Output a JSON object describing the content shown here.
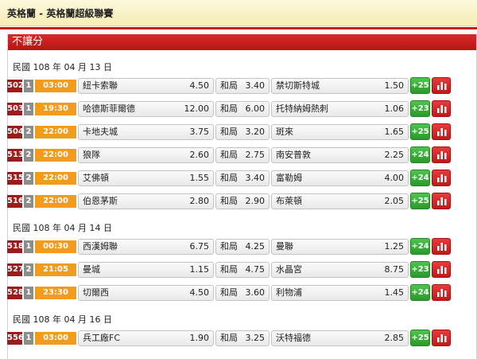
{
  "header": {
    "title": "英格蘭 - 英格蘭超級聯賽"
  },
  "panel": {
    "title": "不讓分"
  },
  "colors": {
    "match_no": "#9e1b1b",
    "league": "#8c8c8c",
    "time": "#f29b1d",
    "more": "#2a9a2a",
    "stats": "#c11919",
    "panel_head": "#c8161d"
  },
  "dates": [
    {
      "label": "民國 108 年 04 月 13 日",
      "matches": [
        {
          "no": "502",
          "lg": "1",
          "time": "03:00 (六)",
          "home": "紐卡索聯",
          "home_odds": "4.50",
          "draw": "和局",
          "draw_odds": "3.40",
          "away": "禁切斯特城",
          "away_odds": "1.50",
          "more": "+25"
        },
        {
          "no": "503",
          "lg": "1",
          "time": "19:30 (六)",
          "home": "哈德斯菲爾德",
          "home_odds": "12.00",
          "draw": "和局",
          "draw_odds": "6.00",
          "away": "托特納姆熱刺",
          "away_odds": "1.06",
          "more": "+23"
        },
        {
          "no": "504",
          "lg": "2",
          "time": "22:00 (六)",
          "home": "卡地夫城",
          "home_odds": "3.75",
          "draw": "和局",
          "draw_odds": "3.20",
          "away": "斑來",
          "away_odds": "1.65",
          "more": "+25"
        },
        {
          "no": "513",
          "lg": "2",
          "time": "22:00 (六)",
          "home": "狼隊",
          "home_odds": "2.60",
          "draw": "和局",
          "draw_odds": "2.75",
          "away": "南安普敦",
          "away_odds": "2.25",
          "more": "+24"
        },
        {
          "no": "515",
          "lg": "2",
          "time": "22:00 (六)",
          "home": "艾佛頓",
          "home_odds": "1.55",
          "draw": "和局",
          "draw_odds": "3.40",
          "away": "富勒姆",
          "away_odds": "4.00",
          "more": "+24"
        },
        {
          "no": "516",
          "lg": "2",
          "time": "22:00 (六)",
          "home": "伯恩茅斯",
          "home_odds": "2.80",
          "draw": "和局",
          "draw_odds": "2.90",
          "away": "布萊頓",
          "away_odds": "2.05",
          "more": "+25"
        }
      ]
    },
    {
      "label": "民國 108 年 04 月 14 日",
      "matches": [
        {
          "no": "518",
          "lg": "1",
          "time": "00:30 (日)",
          "home": "西漢姆聯",
          "home_odds": "6.75",
          "draw": "和局",
          "draw_odds": "4.25",
          "away": "曼聯",
          "away_odds": "1.25",
          "more": "+24"
        },
        {
          "no": "527",
          "lg": "2",
          "time": "21:05 (日)",
          "home": "曼城",
          "home_odds": "1.15",
          "draw": "和局",
          "draw_odds": "4.75",
          "away": "水晶宮",
          "away_odds": "8.75",
          "more": "+23"
        },
        {
          "no": "528",
          "lg": "1",
          "time": "23:30 (日)",
          "home": "切爾西",
          "home_odds": "4.50",
          "draw": "和局",
          "draw_odds": "3.60",
          "away": "利物浦",
          "away_odds": "1.45",
          "more": "+24"
        }
      ]
    },
    {
      "label": "民國 108 年 04 月 16 日",
      "matches": [
        {
          "no": "556",
          "lg": "1",
          "time": "03:00 (二)",
          "home": "兵工廠FC",
          "home_odds": "1.90",
          "draw": "和局",
          "draw_odds": "3.25",
          "away": "沃特福德",
          "away_odds": "2.85",
          "more": "+25"
        }
      ]
    }
  ]
}
